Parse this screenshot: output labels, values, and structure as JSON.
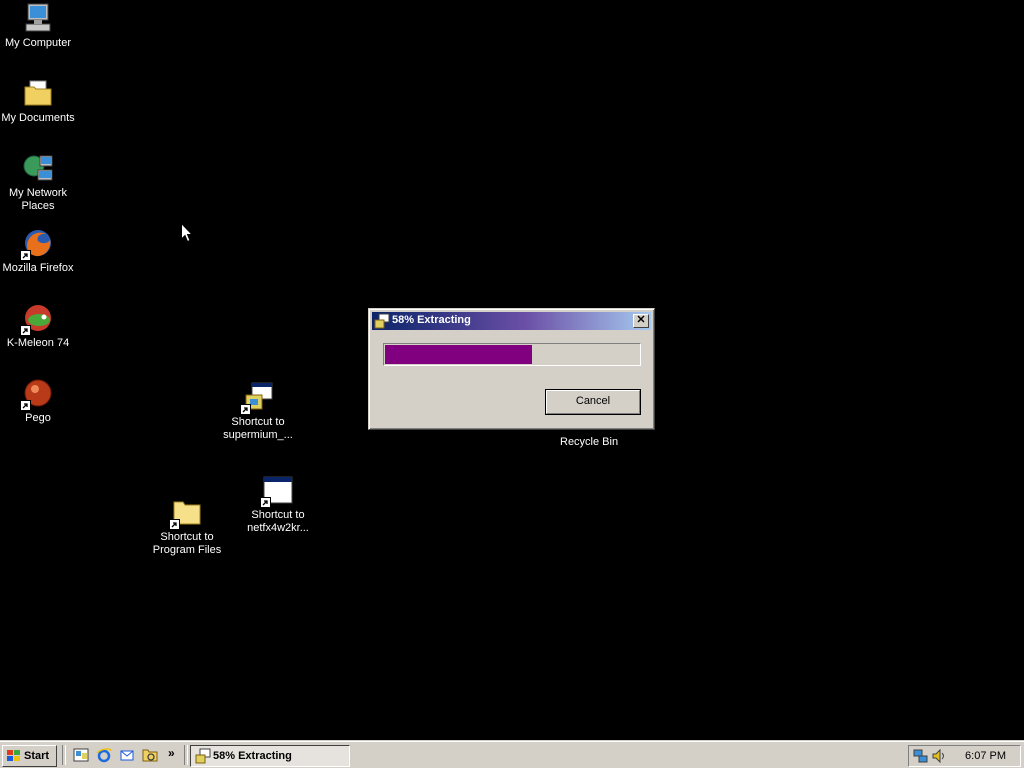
{
  "desktop_icons": [
    {
      "label": "My Computer",
      "icon": "computer-icon"
    },
    {
      "label": "My Documents",
      "icon": "documents-folder-icon"
    },
    {
      "label": "My Network Places",
      "icon": "network-icon"
    },
    {
      "label": "Mozilla Firefox",
      "icon": "firefox-icon"
    },
    {
      "label": "K-Meleon 74",
      "icon": "kmeleon-icon"
    },
    {
      "label": "Pego",
      "icon": "pego-icon"
    },
    {
      "label": "Shortcut to supermium_...",
      "icon": "installer-icon"
    },
    {
      "label": "Shortcut to Program Files",
      "icon": "folder-icon"
    },
    {
      "label": "Shortcut to netfx4w2kr...",
      "icon": "window-app-icon"
    },
    {
      "label": "Recycle Bin",
      "icon": "recycle-bin-icon"
    }
  ],
  "dialog": {
    "title": "58% Extracting",
    "progress": 0.58,
    "progress_color": "#800080",
    "cancel_label": "Cancel",
    "close_glyph": "✕"
  },
  "taskbar": {
    "start_label": "Start",
    "more_glyph": "»",
    "quick_launch": [
      "show-desktop-icon",
      "ie-icon",
      "outlook-icon",
      "explorer-icon"
    ],
    "task_label": "58% Extracting",
    "tray_icons": [
      "network-tray-icon",
      "volume-tray-icon"
    ],
    "clock": "6:07 PM"
  }
}
